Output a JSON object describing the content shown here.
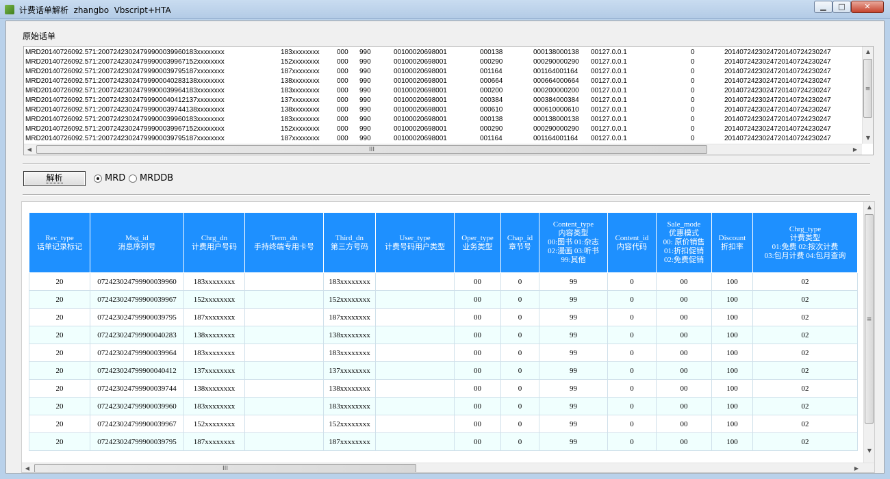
{
  "window": {
    "title": "计费话单解析  zhangbo  Vbscript+HTA",
    "minimize": "▁",
    "maximize": "□",
    "close": "✕"
  },
  "raw": {
    "label": "原始话单",
    "lines": [
      [
        "MRD20140726092.571:20072423024799900039960183xxxxxxxx",
        "183xxxxxxxx",
        "000",
        "990",
        "00100020698001",
        "000138",
        "000138000138",
        "00127.0.0.1",
        "0",
        "2014072423024720140724230247"
      ],
      [
        "MRD20140726092.571:20072423024799900039967152xxxxxxxx",
        "152xxxxxxxx",
        "000",
        "990",
        "00100020698001",
        "000290",
        "000290000290",
        "00127.0.0.1",
        "0",
        "2014072423024720140724230247"
      ],
      [
        "MRD20140726092.571:20072423024799900039795187xxxxxxxx",
        "187xxxxxxxx",
        "000",
        "990",
        "00100020698001",
        "001164",
        "001164001164",
        "00127.0.0.1",
        "0",
        "2014072423024720140724230247"
      ],
      [
        "MRD20140726092.571:20072423024799900040283138xxxxxxxx",
        "138xxxxxxxx",
        "000",
        "990",
        "00100020698001",
        "000664",
        "000664000664",
        "00127.0.0.1",
        "0",
        "2014072423024720140724230247"
      ],
      [
        "MRD20140726092.571:20072423024799900039964183xxxxxxxx",
        "183xxxxxxxx",
        "000",
        "990",
        "00100020698001",
        "000200",
        "000200000200",
        "00127.0.0.1",
        "0",
        "2014072423024720140724230247"
      ],
      [
        "MRD20140726092.571:20072423024799900040412137xxxxxxxx",
        "137xxxxxxxx",
        "000",
        "990",
        "00100020698001",
        "000384",
        "000384000384",
        "00127.0.0.1",
        "0",
        "2014072423024720140724230247"
      ],
      [
        "MRD20140726092.571:20072423024799900039744138xxxxxxxx",
        "138xxxxxxxx",
        "000",
        "990",
        "00100020698001",
        "000610",
        "000610000610",
        "00127.0.0.1",
        "0",
        "2014072423024720140724230247"
      ],
      [
        "MRD20140726092.571:20072423024799900039960183xxxxxxxx",
        "183xxxxxxxx",
        "000",
        "990",
        "00100020698001",
        "000138",
        "000138000138",
        "00127.0.0.1",
        "0",
        "2014072423024720140724230247"
      ],
      [
        "MRD20140726092.571:20072423024799900039967152xxxxxxxx",
        "152xxxxxxxx",
        "000",
        "990",
        "00100020698001",
        "000290",
        "000290000290",
        "00127.0.0.1",
        "0",
        "2014072423024720140724230247"
      ],
      [
        "MRD20140726092.571:20072423024799900039795187xxxxxxxx",
        "187xxxxxxxx",
        "000",
        "990",
        "00100020698001",
        "001164",
        "001164001164",
        "00127.0.0.1",
        "0",
        "2014072423024720140724230247"
      ]
    ]
  },
  "controls": {
    "parse_button": "解析",
    "radio_mrd": "MRD",
    "radio_mrddb": "MRDDB",
    "selected": "MRD"
  },
  "scroll": {
    "up": "▲",
    "down": "▼",
    "left": "◀",
    "right": "▶",
    "grip_h": "III",
    "grip_v": "≡"
  },
  "grid": {
    "headers": [
      [
        "Rec_type",
        "话单记录标记"
      ],
      [
        "Msg_id",
        "消息序列号"
      ],
      [
        "Chrg_dn",
        "计费用户号码"
      ],
      [
        "Term_dn",
        "手持终端专用卡号"
      ],
      [
        "Third_dn",
        "第三方号码"
      ],
      [
        "User_type",
        "计费号码用户类型"
      ],
      [
        "Oper_type",
        "业务类型"
      ],
      [
        "Chap_id",
        "章节号"
      ],
      [
        "Content_type",
        "内容类型",
        "00:图书  01:杂志",
        "02:漫画  03:听书",
        "99:其他"
      ],
      [
        "Content_id",
        "内容代码"
      ],
      [
        "Sale_mode",
        "优惠模式",
        "00: 原价销售",
        "01:折扣促销",
        "02:免费促销"
      ],
      [
        "Discount",
        "折扣率"
      ],
      [
        "Chrg_type",
        "计费类型",
        "01:免费  02:按次计费",
        "03:包月计费  04:包月查询"
      ]
    ],
    "rows": [
      [
        "20",
        "072423024799900039960",
        "183xxxxxxxx",
        "",
        "183xxxxxxxx",
        "",
        "00",
        "0",
        "99",
        "0",
        "00",
        "100",
        "02"
      ],
      [
        "20",
        "072423024799900039967",
        "152xxxxxxxx",
        "",
        "152xxxxxxxx",
        "",
        "00",
        "0",
        "99",
        "0",
        "00",
        "100",
        "02"
      ],
      [
        "20",
        "072423024799900039795",
        "187xxxxxxxx",
        "",
        "187xxxxxxxx",
        "",
        "00",
        "0",
        "99",
        "0",
        "00",
        "100",
        "02"
      ],
      [
        "20",
        "072423024799900040283",
        "138xxxxxxxx",
        "",
        "138xxxxxxxx",
        "",
        "00",
        "0",
        "99",
        "0",
        "00",
        "100",
        "02"
      ],
      [
        "20",
        "072423024799900039964",
        "183xxxxxxxx",
        "",
        "183xxxxxxxx",
        "",
        "00",
        "0",
        "99",
        "0",
        "00",
        "100",
        "02"
      ],
      [
        "20",
        "072423024799900040412",
        "137xxxxxxxx",
        "",
        "137xxxxxxxx",
        "",
        "00",
        "0",
        "99",
        "0",
        "00",
        "100",
        "02"
      ],
      [
        "20",
        "072423024799900039744",
        "138xxxxxxxx",
        "",
        "138xxxxxxxx",
        "",
        "00",
        "0",
        "99",
        "0",
        "00",
        "100",
        "02"
      ],
      [
        "20",
        "072423024799900039960",
        "183xxxxxxxx",
        "",
        "183xxxxxxxx",
        "",
        "00",
        "0",
        "99",
        "0",
        "00",
        "100",
        "02"
      ],
      [
        "20",
        "072423024799900039967",
        "152xxxxxxxx",
        "",
        "152xxxxxxxx",
        "",
        "00",
        "0",
        "99",
        "0",
        "00",
        "100",
        "02"
      ],
      [
        "20",
        "072423024799900039795",
        "187xxxxxxxx",
        "",
        "187xxxxxxxx",
        "",
        "00",
        "0",
        "99",
        "0",
        "00",
        "100",
        "02"
      ]
    ]
  }
}
